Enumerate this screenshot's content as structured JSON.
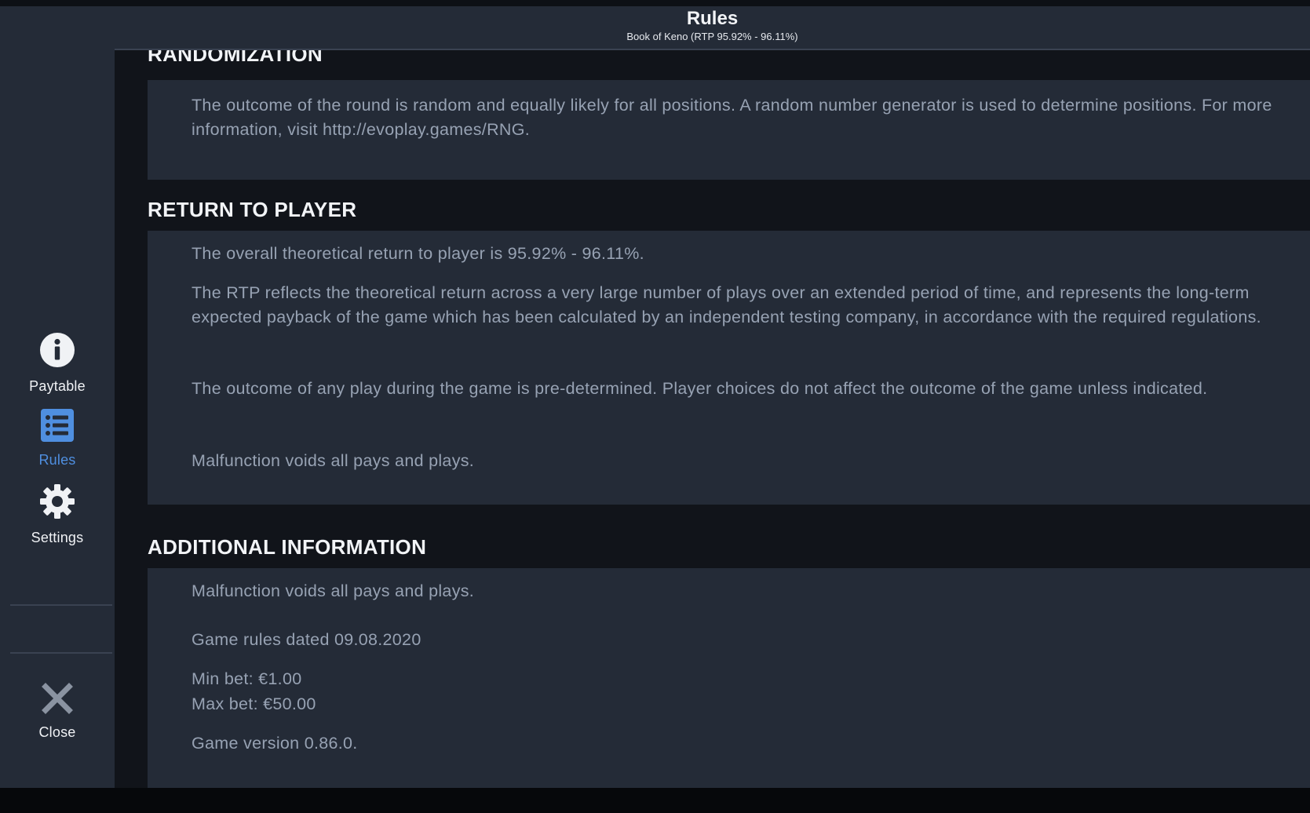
{
  "header": {
    "title": "Rules",
    "subtitle": "Book of Keno (RTP 95.92% - 96.11%)"
  },
  "sidebar": {
    "items": [
      {
        "label": "Paytable",
        "icon": "info-icon",
        "active": false
      },
      {
        "label": "Rules",
        "icon": "list-icon",
        "active": true
      },
      {
        "label": "Settings",
        "icon": "gear-icon",
        "active": false
      }
    ],
    "close": {
      "label": "Close",
      "icon": "close-icon"
    }
  },
  "colors": {
    "accent": "#4f8fe0",
    "panel": "#242b37",
    "body_text": "#97a2b3",
    "heading": "#f2f4f7"
  },
  "sections": {
    "randomization": {
      "heading": "RANDOMIZATION",
      "paragraphs": [
        "The outcome of the round is random and equally likely for all positions. A random number generator is used to determine positions. For more information, visit http://evoplay.games/RNG."
      ]
    },
    "rtp": {
      "heading": "RETURN TO PLAYER",
      "paragraphs": [
        "The overall theoretical return to player is 95.92% - 96.11%.",
        "The RTP reflects the theoretical return across a very large number of plays over an extended period of time, and represents the long-term expected payback of the game which has been calculated by an independent testing company, in accordance with the required regulations.",
        "The outcome of any play during the game is pre-determined. Player choices do not affect the outcome of the game unless indicated.",
        "Malfunction voids all pays and plays."
      ]
    },
    "additional": {
      "heading": "ADDITIONAL INFORMATION",
      "paragraphs": [
        "Malfunction voids all pays and plays.",
        "Game rules dated 09.08.2020",
        "Min bet: €1.00",
        "Max bet: €50.00",
        "Game version 0.86.0."
      ]
    }
  }
}
